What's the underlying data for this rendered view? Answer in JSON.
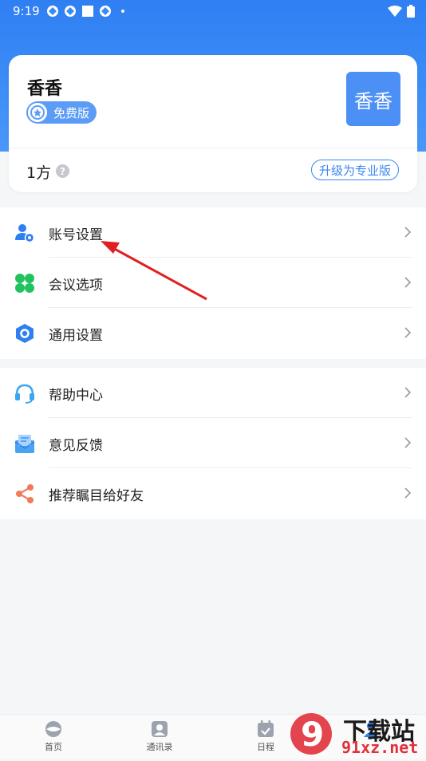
{
  "status_bar": {
    "time": "9:19"
  },
  "profile": {
    "name": "香香",
    "plan": "免费版",
    "avatar_text": "香香",
    "capacity": "1方",
    "help_glyph": "?",
    "upgrade_label": "升级为专业版"
  },
  "menu_group_1": [
    {
      "label": "账号设置",
      "icon": "user-settings-icon"
    },
    {
      "label": "会议选项",
      "icon": "clover-icon"
    },
    {
      "label": "通用设置",
      "icon": "hexagon-settings-icon"
    }
  ],
  "menu_group_2": [
    {
      "label": "帮助中心",
      "icon": "headset-icon"
    },
    {
      "label": "意见反馈",
      "icon": "feedback-mail-icon"
    },
    {
      "label": "推荐瞩目给好友",
      "icon": "share-icon"
    }
  ],
  "bottom_nav": [
    {
      "label": "首页",
      "icon": "home-icon"
    },
    {
      "label": "通讯录",
      "icon": "contacts-icon"
    },
    {
      "label": "日程",
      "icon": "calendar-icon"
    },
    {
      "label": "",
      "icon": "profile-icon"
    }
  ],
  "watermark": {
    "line1": "下载站",
    "line2": "91xz.net",
    "logo_glyph": "9"
  },
  "colors": {
    "primary_blue": "#2f7ff3",
    "avatar_blue": "#4d90f5",
    "green": "#22c35e",
    "orange": "#f07a5a",
    "annotation_red": "#e02020"
  }
}
